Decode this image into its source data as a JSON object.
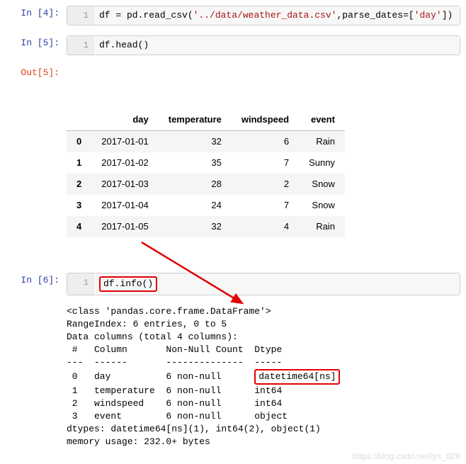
{
  "cells": {
    "in4": {
      "prompt": "In [4]:",
      "lineno": "1",
      "code_a": "df = pd.read_csv(",
      "code_str1": "'../data/weather_data.csv'",
      "code_b": ",parse_dates=[",
      "code_str2": "'day'",
      "code_c": "])"
    },
    "in5": {
      "prompt": "In [5]:",
      "lineno": "1",
      "code": "df.head()"
    },
    "out5": {
      "prompt": "Out[5]:"
    },
    "in6": {
      "prompt": "In [6]:",
      "lineno": "1",
      "code": "df.info()"
    }
  },
  "table": {
    "columns": [
      "",
      "day",
      "temperature",
      "windspeed",
      "event"
    ],
    "rows": [
      {
        "idx": "0",
        "day": "2017-01-01",
        "temperature": "32",
        "windspeed": "6",
        "event": "Rain"
      },
      {
        "idx": "1",
        "day": "2017-01-02",
        "temperature": "35",
        "windspeed": "7",
        "event": "Sunny"
      },
      {
        "idx": "2",
        "day": "2017-01-03",
        "temperature": "28",
        "windspeed": "2",
        "event": "Snow"
      },
      {
        "idx": "3",
        "day": "2017-01-04",
        "temperature": "24",
        "windspeed": "7",
        "event": "Snow"
      },
      {
        "idx": "4",
        "day": "2017-01-05",
        "temperature": "32",
        "windspeed": "4",
        "event": "Rain"
      }
    ]
  },
  "info": {
    "line1": "<class 'pandas.core.frame.DataFrame'>",
    "line2": "RangeIndex: 6 entries, 0 to 5",
    "line3": "Data columns (total 4 columns):",
    "line4": " #   Column       Non-Null Count  Dtype",
    "line5": "---  ------       --------------  -----",
    "line6a": " 0   day          6 non-null      ",
    "line6b": "datetime64[ns]",
    "line7": " 1   temperature  6 non-null      int64",
    "line8": " 2   windspeed    6 non-null      int64",
    "line9": " 3   event        6 non-null      object",
    "line10": "dtypes: datetime64[ns](1), int64(2), object(1)",
    "line11": "memory usage: 232.0+ bytes"
  },
  "watermark": "https://blog.csdn.net/lys_828"
}
